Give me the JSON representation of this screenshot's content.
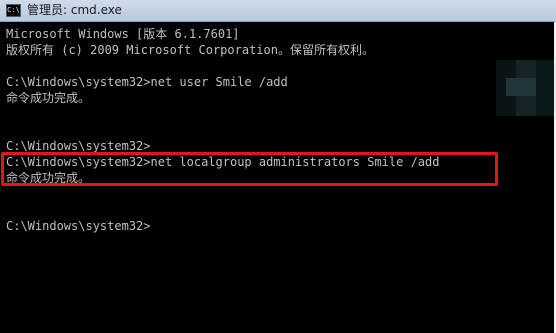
{
  "window": {
    "title": "管理员: cmd.exe",
    "icon": "cmd-icon",
    "icon_glyph": "C:\\"
  },
  "console": {
    "lines": [
      "Microsoft Windows [版本 6.1.7601]",
      "版权所有 (c) 2009 Microsoft Corporation。保留所有权利。",
      "",
      "C:\\Windows\\system32>net user Smile /add",
      "命令成功完成。",
      "",
      "",
      "C:\\Windows\\system32>",
      "C:\\Windows\\system32>net localgroup administrators Smile /add",
      "命令成功完成。",
      "",
      "",
      "C:\\Windows\\system32>"
    ]
  },
  "colors": {
    "background": "#000000",
    "text": "#c0c0c0",
    "highlight_border": "#e0161b",
    "titlebar": "#cfdcea"
  }
}
